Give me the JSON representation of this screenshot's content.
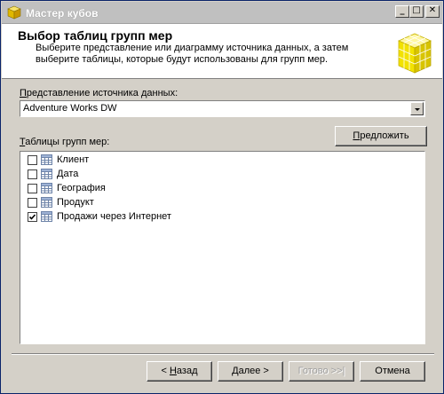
{
  "window": {
    "title": "Мастер кубов",
    "controls": {
      "minimize": "_",
      "maximize": "□",
      "close": "✕"
    }
  },
  "header": {
    "title": "Выбор таблиц групп мер",
    "description": "Выберите представление или диаграмму источника данных, а затем выберите таблицы, которые будут использованы для групп мер."
  },
  "data_source": {
    "label_prefix": "",
    "label_access": "П",
    "label_rest": "редставление источника данных:",
    "selected": "Adventure Works DW"
  },
  "tables": {
    "label_access": "Т",
    "label_rest": "аблицы групп мер:",
    "suggest_access": "П",
    "suggest_rest": "редложить",
    "items": [
      {
        "label": "Клиент",
        "checked": false
      },
      {
        "label": "Дата",
        "checked": false
      },
      {
        "label": "География",
        "checked": false
      },
      {
        "label": "Продукт",
        "checked": false
      },
      {
        "label": "Продажи через Интернет",
        "checked": true
      }
    ]
  },
  "footer": {
    "back_prefix": "< ",
    "back_access": "Н",
    "back_rest": "азад",
    "next_access": "Д",
    "next_rest": "алее >",
    "finish": "Готово >>|",
    "cancel": "Отмена"
  },
  "colors": {
    "titlebar": "#c0c0c0",
    "face": "#d4d0c8",
    "cube_yellow": "#f2e200"
  }
}
